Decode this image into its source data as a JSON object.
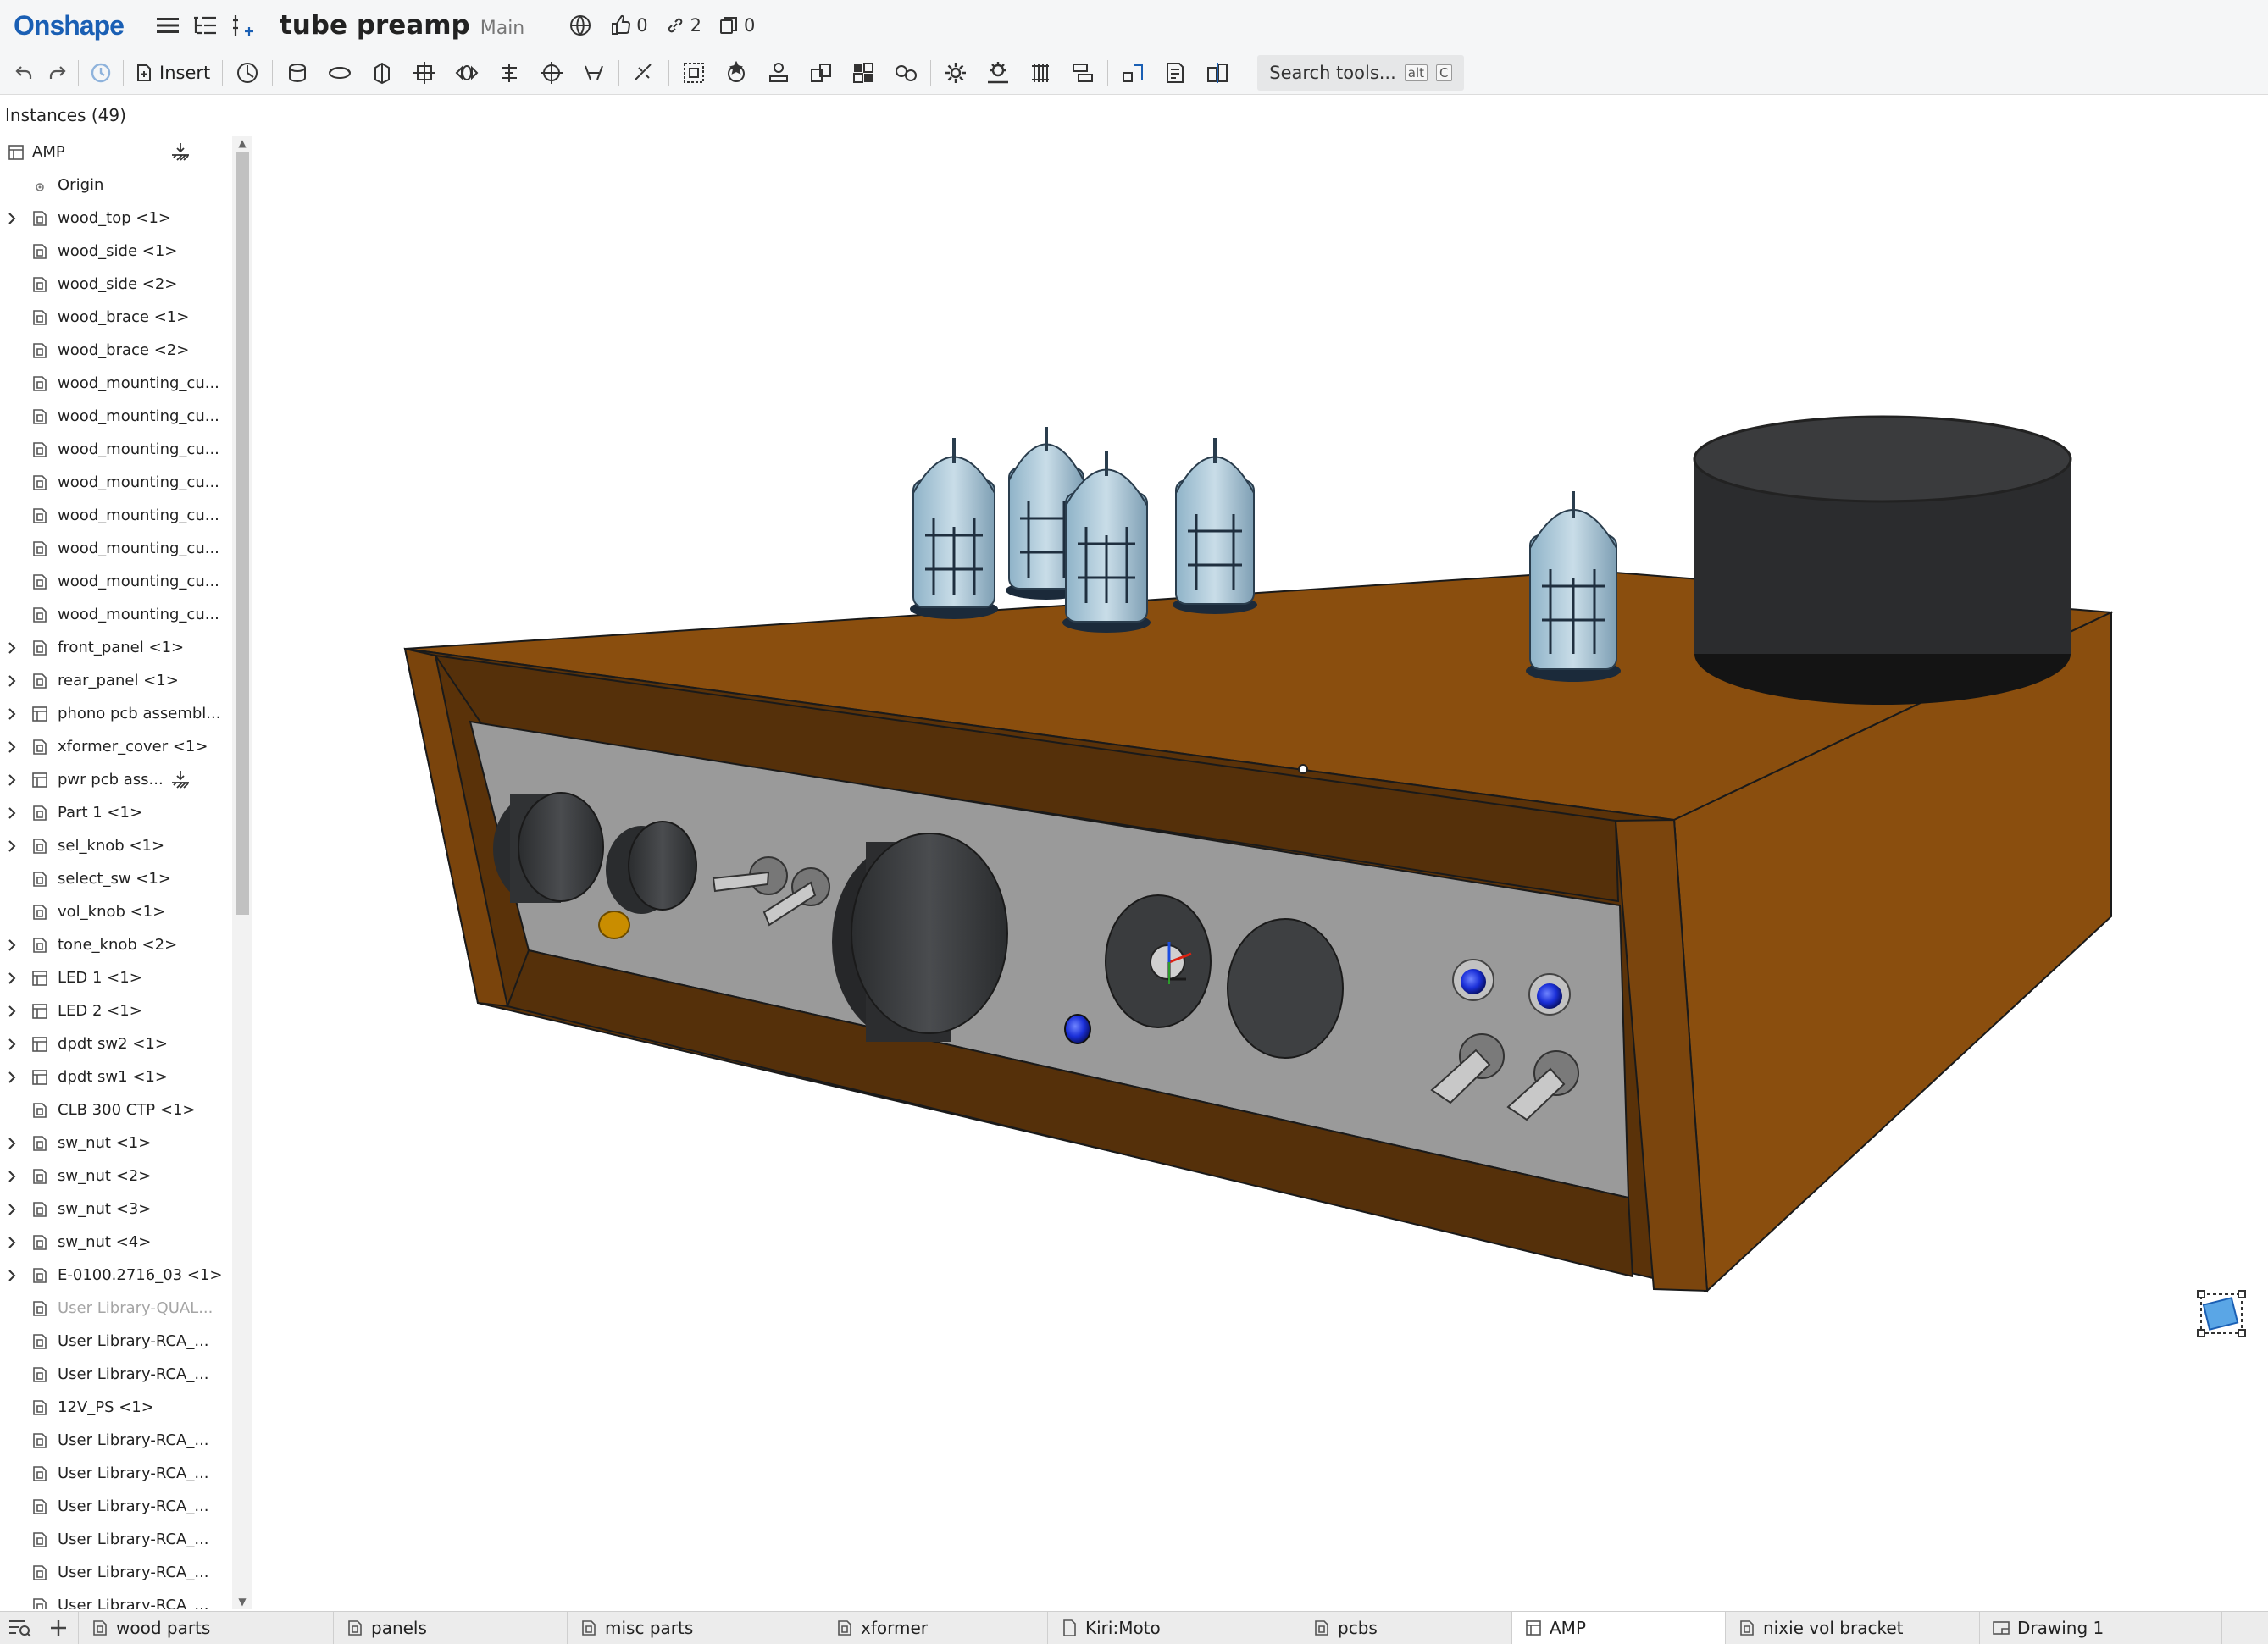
{
  "app": {
    "logo": "Onshape"
  },
  "document": {
    "title": "tube preamp",
    "branch": "Main"
  },
  "social": {
    "likes": "0",
    "links": "2",
    "copies": "0"
  },
  "toolbar": {
    "insert_label": "Insert",
    "search_placeholder": "Search tools...",
    "search_kbd_1": "alt",
    "search_kbd_2": "C"
  },
  "panel": {
    "header": "Instances (49)",
    "items": [
      {
        "label": "AMP",
        "type": "root"
      },
      {
        "label": "Origin",
        "type": "origin"
      },
      {
        "label": "wood_top <1>",
        "expandable": true,
        "icon": "part-studio-icon"
      },
      {
        "label": "wood_side <1>",
        "expandable": false,
        "icon": "part-studio-icon"
      },
      {
        "label": "wood_side <2>",
        "expandable": false,
        "icon": "part-studio-icon"
      },
      {
        "label": "wood_brace <1>",
        "expandable": false,
        "icon": "part-studio-icon"
      },
      {
        "label": "wood_brace <2>",
        "expandable": false,
        "icon": "part-studio-icon"
      },
      {
        "label": "wood_mounting_cu...",
        "expandable": false,
        "icon": "part-studio-icon"
      },
      {
        "label": "wood_mounting_cu...",
        "expandable": false,
        "icon": "part-studio-icon"
      },
      {
        "label": "wood_mounting_cu...",
        "expandable": false,
        "icon": "part-studio-icon"
      },
      {
        "label": "wood_mounting_cu...",
        "expandable": false,
        "icon": "part-studio-icon"
      },
      {
        "label": "wood_mounting_cu...",
        "expandable": false,
        "icon": "part-studio-icon"
      },
      {
        "label": "wood_mounting_cu...",
        "expandable": false,
        "icon": "part-studio-icon"
      },
      {
        "label": "wood_mounting_cu...",
        "expandable": false,
        "icon": "part-studio-icon"
      },
      {
        "label": "wood_mounting_cu...",
        "expandable": false,
        "icon": "part-studio-icon"
      },
      {
        "label": "front_panel <1>",
        "expandable": true,
        "icon": "part-studio-icon"
      },
      {
        "label": "rear_panel <1>",
        "expandable": true,
        "icon": "part-studio-icon"
      },
      {
        "label": "phono pcb assembl...",
        "expandable": true,
        "icon": "assembly-icon"
      },
      {
        "label": "xformer_cover <1>",
        "expandable": true,
        "icon": "part-studio-icon"
      },
      {
        "label": "pwr pcb ass...",
        "expandable": true,
        "icon": "assembly-icon",
        "side_icon": true
      },
      {
        "label": "Part 1 <1>",
        "expandable": true,
        "icon": "part-studio-icon"
      },
      {
        "label": "sel_knob <1>",
        "expandable": true,
        "icon": "part-studio-icon"
      },
      {
        "label": "select_sw <1>",
        "expandable": false,
        "icon": "part-studio-icon"
      },
      {
        "label": "vol_knob <1>",
        "expandable": false,
        "icon": "part-studio-icon"
      },
      {
        "label": "tone_knob <2>",
        "expandable": true,
        "icon": "part-studio-icon"
      },
      {
        "label": "LED 1 <1>",
        "expandable": true,
        "icon": "assembly-icon"
      },
      {
        "label": "LED 2 <1>",
        "expandable": true,
        "icon": "assembly-icon"
      },
      {
        "label": "dpdt sw2 <1>",
        "expandable": true,
        "icon": "assembly-icon"
      },
      {
        "label": "dpdt sw1 <1>",
        "expandable": true,
        "icon": "assembly-icon"
      },
      {
        "label": "CLB 300 CTP <1>",
        "expandable": false,
        "icon": "part-studio-icon"
      },
      {
        "label": "sw_nut <1>",
        "expandable": true,
        "icon": "part-studio-icon"
      },
      {
        "label": "sw_nut <2>",
        "expandable": true,
        "icon": "part-studio-icon"
      },
      {
        "label": "sw_nut <3>",
        "expandable": true,
        "icon": "part-studio-icon"
      },
      {
        "label": "sw_nut <4>",
        "expandable": true,
        "icon": "part-studio-icon"
      },
      {
        "label": "E-0100.2716_03 <1>",
        "expandable": true,
        "icon": "part-studio-icon"
      },
      {
        "label": "User Library-QUAL...",
        "expandable": false,
        "icon": "part-studio-icon",
        "dim": true
      },
      {
        "label": "User Library-RCA_...",
        "expandable": false,
        "icon": "part-studio-icon"
      },
      {
        "label": "User Library-RCA_...",
        "expandable": false,
        "icon": "part-studio-icon"
      },
      {
        "label": "12V_PS <1>",
        "expandable": false,
        "icon": "part-studio-icon"
      },
      {
        "label": "User Library-RCA_...",
        "expandable": false,
        "icon": "part-studio-icon"
      },
      {
        "label": "User Library-RCA_...",
        "expandable": false,
        "icon": "part-studio-icon"
      },
      {
        "label": "User Library-RCA_...",
        "expandable": false,
        "icon": "part-studio-icon"
      },
      {
        "label": "User Library-RCA_...",
        "expandable": false,
        "icon": "part-studio-icon"
      },
      {
        "label": "User Library-RCA_...",
        "expandable": false,
        "icon": "part-studio-icon"
      },
      {
        "label": "User Library-RCA_...",
        "expandable": false,
        "icon": "part-studio-icon"
      }
    ]
  },
  "tabs": [
    {
      "label": "wood parts",
      "icon": "part-studio-icon",
      "active": false
    },
    {
      "label": "panels",
      "icon": "part-studio-icon",
      "active": false
    },
    {
      "label": "misc parts",
      "icon": "part-studio-icon",
      "active": false
    },
    {
      "label": "xformer",
      "icon": "part-studio-icon",
      "active": false
    },
    {
      "label": "Kiri:Moto",
      "icon": "app-icon",
      "active": false
    },
    {
      "label": "pcbs",
      "icon": "part-studio-icon",
      "active": false
    },
    {
      "label": "AMP",
      "icon": "assembly-icon",
      "active": true
    },
    {
      "label": "nixie vol bracket",
      "icon": "part-studio-icon",
      "active": false
    },
    {
      "label": "Drawing 1",
      "icon": "drawing-icon",
      "active": false
    }
  ],
  "colors": {
    "brand": "#1a5fb4",
    "wood": "#8a4e0e",
    "wood_dark": "#55300a",
    "panel": "#9a9a9a",
    "knob": "#3a3c3e",
    "led": "#1a2fd8"
  }
}
